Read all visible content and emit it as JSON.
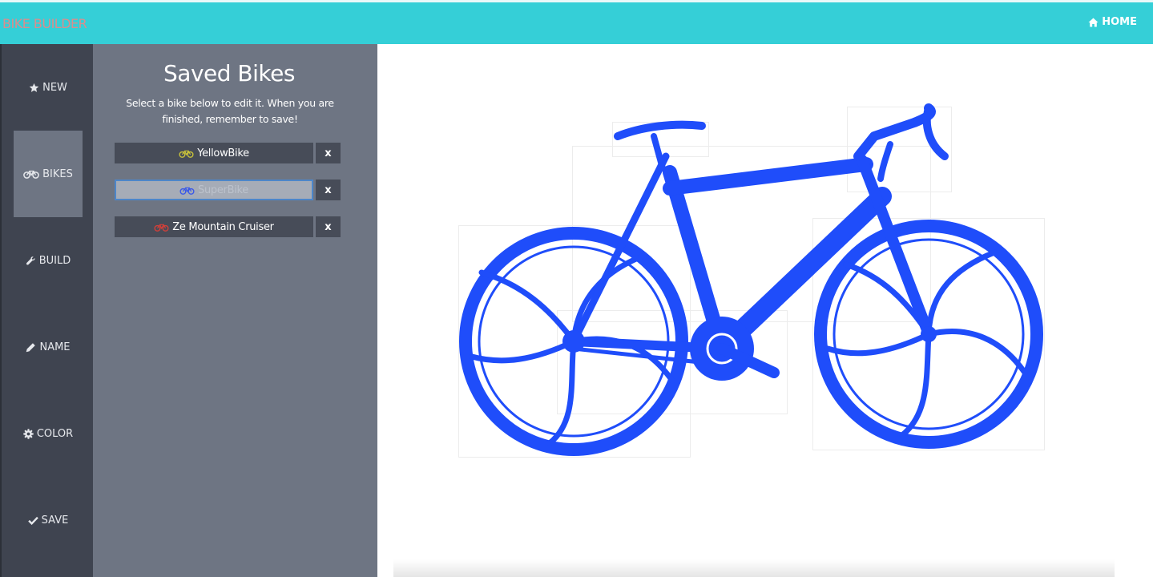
{
  "header": {
    "brand": "BIKE BUILDER",
    "home_label": "HOME",
    "home_icon": "home-icon"
  },
  "nav": {
    "items": [
      {
        "label": "NEW",
        "icon": "star-icon"
      },
      {
        "label": "BIKES",
        "icon": "bicycle-icon"
      },
      {
        "label": "BUILD",
        "icon": "wrench-icon"
      },
      {
        "label": "NAME",
        "icon": "pencil-icon"
      },
      {
        "label": "COLOR",
        "icon": "gear-icon"
      },
      {
        "label": "SAVE",
        "icon": "check-icon"
      }
    ],
    "active": "BIKES"
  },
  "panel": {
    "title": "Saved Bikes",
    "description": "Select a bike below to edit it. When you are finished, remember to save!",
    "bikes": [
      {
        "name": "YellowBike",
        "icon_color": "#c9c23a",
        "delete_label": "x"
      },
      {
        "name": "SuperBike",
        "icon_color": "#3b59e8",
        "delete_label": "x",
        "selected": true
      },
      {
        "name": "Ze Mountain Cruiser",
        "icon_color": "#d0403a",
        "delete_label": "x"
      }
    ]
  },
  "canvas": {
    "bike_color": "#1f4dfa"
  },
  "colors": {
    "topbar": "#35cfd7",
    "sidebar": "#3f4450",
    "panel": "#6e7583",
    "brand_text": "#d98e8e"
  }
}
